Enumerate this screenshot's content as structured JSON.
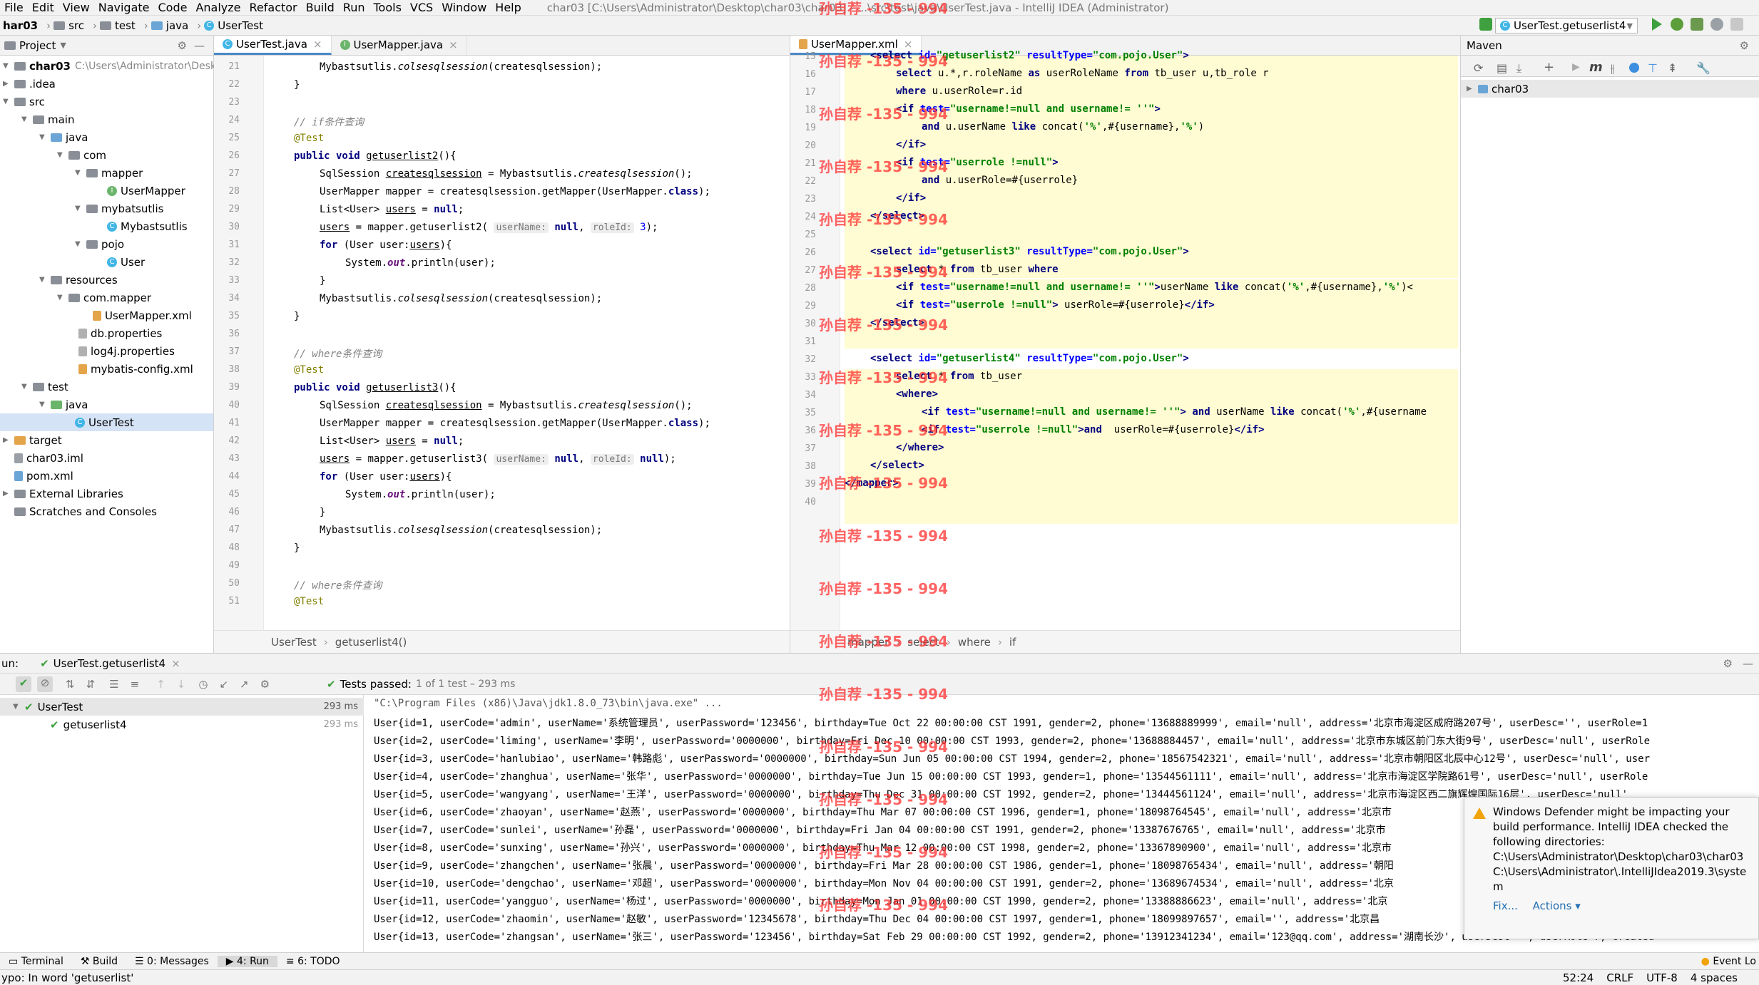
{
  "menu": [
    "File",
    "Edit",
    "View",
    "Navigate",
    "Code",
    "Analyze",
    "Refactor",
    "Build",
    "Run",
    "Tools",
    "VCS",
    "Window",
    "Help"
  ],
  "window_title": "char03 [C:\\Users\\Administrator\\Desktop\\char03\\char03] - ...\\src\\test\\java\\UserTest.java - IntelliJ IDEA (Administrator)",
  "breadcrumb": [
    "har03",
    "src",
    "test",
    "java",
    "UserTest"
  ],
  "run_config": "UserTest.getuserlist4",
  "project": {
    "header": "Project",
    "root": "char03",
    "root_path": "C:\\Users\\Administrator\\Deskt",
    "items": [
      ".idea",
      "src",
      "main",
      "java",
      "com",
      "mapper",
      "UserMapper",
      "mybatsutlis",
      "Mybastsutlis",
      "pojo",
      "User",
      "resources",
      "com.mapper",
      "UserMapper.xml",
      "db.properties",
      "log4j.properties",
      "mybatis-config.xml",
      "test",
      "java",
      "UserTest",
      "target",
      "char03.iml",
      "pom.xml",
      "External Libraries",
      "Scratches and Consoles"
    ]
  },
  "editor1": {
    "tabs": [
      "UserTest.java",
      "UserMapper.java"
    ],
    "line_numbers": [
      "21",
      "22",
      "23",
      "24",
      "25",
      "26",
      "27",
      "28",
      "29",
      "30",
      "31",
      "32",
      "33",
      "34",
      "35",
      "36",
      "37",
      "38",
      "39",
      "40",
      "41",
      "42",
      "43",
      "44",
      "45",
      "46",
      "47",
      "48",
      "49",
      "50",
      "51"
    ],
    "breadcrumb": [
      "UserTest",
      "getuserlist4()"
    ],
    "comments": [
      "// if条件查询",
      "// where条件查询",
      "// where条件查询"
    ]
  },
  "editor2": {
    "tab": "UserMapper.xml",
    "line_numbers": [
      "15",
      "16",
      "17",
      "18",
      "19",
      "20",
      "21",
      "22",
      "23",
      "24",
      "25",
      "26",
      "27",
      "28",
      "29",
      "30",
      "31",
      "32",
      "33",
      "34",
      "35",
      "36",
      "37",
      "38",
      "39",
      "40"
    ],
    "breadcrumb": [
      "mapper",
      "select",
      "where",
      "if"
    ]
  },
  "maven": {
    "header": "Maven",
    "root": "char03"
  },
  "run": {
    "label": "un:",
    "tab": "UserTest.getuserlist4",
    "tests_passed": "Tests passed:",
    "tests_count": "1 of 1 test – 293 ms",
    "tree": [
      {
        "name": "UserTest",
        "time": "293 ms"
      },
      {
        "name": "getuserlist4",
        "time": "293 ms"
      }
    ],
    "console": [
      "\"C:\\Program Files (x86)\\Java\\jdk1.8.0_73\\bin\\java.exe\" ...",
      "User{id=1, userCode='admin', userName='系统管理员', userPassword='123456', birthday=Tue Oct 22 00:00:00 CST 1991, gender=2, phone='13688889999', email='null', address='北京市海淀区成府路207号', userDesc='', userRole=1",
      "User{id=2, userCode='liming', userName='李明', userPassword='0000000', birthday=Fri Dec 10 00:00:00 CST 1993, gender=2, phone='13688884457', email='null', address='北京市东城区前门东大街9号', userDesc='null', userRole",
      "User{id=3, userCode='hanlubiao', userName='韩路彪', userPassword='0000000', birthday=Sun Jun 05 00:00:00 CST 1994, gender=2, phone='18567542321', email='null', address='北京市朝阳区北辰中心12号', userDesc='null', user",
      "User{id=4, userCode='zhanghua', userName='张华', userPassword='0000000', birthday=Tue Jun 15 00:00:00 CST 1993, gender=1, phone='13544561111', email='null', address='北京市海淀区学院路61号', userDesc='null', userRole",
      "User{id=5, userCode='wangyang', userName='王洋', userPassword='0000000', birthday=Thu Dec 31 00:00:00 CST 1992, gender=2, phone='13444561124', email='null', address='北京市海淀区西二旗辉煌国际16层', userDesc='null'",
      "User{id=6, userCode='zhaoyan', userName='赵燕', userPassword='0000000', birthday=Thu Mar 07 00:00:00 CST 1996, gender=1, phone='18098764545', email='null', address='北京市",
      "User{id=7, userCode='sunlei', userName='孙磊', userPassword='0000000', birthday=Fri Jan 04 00:00:00 CST 1991, gender=2, phone='13387676765', email='null', address='北京市",
      "User{id=8, userCode='sunxing', userName='孙兴', userPassword='0000000', birthday=Thu Mar 12 00:00:00 CST 1998, gender=2, phone='13367890900', email='null', address='北京市",
      "User{id=9, userCode='zhangchen', userName='张晨', userPassword='0000000', birthday=Fri Mar 28 00:00:00 CST 1986, gender=1, phone='18098765434', email='null', address='朝阳",
      "User{id=10, userCode='dengchao', userName='邓超', userPassword='0000000', birthday=Mon Nov 04 00:00:00 CST 1991, gender=2, phone='13689674534', email='null', address='北京",
      "User{id=11, userCode='yangguo', userName='杨过', userPassword='0000000', birthday=Mon Jan 01 00:00:00 CST 1990, gender=2, phone='13388886623', email='null', address='北京",
      "User{id=12, userCode='zhaomin', userName='赵敏', userPassword='12345678', birthday=Thu Dec 04 00:00:00 CST 1997, gender=1, phone='18099897657', email='', address='北京昌",
      "User{id=13, userCode='zhangsan', userName='张三', userPassword='123456', birthday=Sat Feb 29 00:00:00 CST 1992, gender=2, phone='13912341234', email='123@qq.com', address='湖南长沙', userDesc='', userRole=7, created"
    ]
  },
  "notification": {
    "text": "Windows Defender might be impacting your build performance. IntelliJ IDEA checked the following directories:",
    "dir1": "C:\\Users\\Administrator\\Desktop\\char03\\char03",
    "dir2": "C:\\Users\\Administrator\\.IntelliJIdea2019.3\\system",
    "fix": "Fix...",
    "actions": "Actions ▾"
  },
  "toolwindows": [
    "Terminal",
    "Build",
    "0: Messages",
    "4: Run",
    "6: TODO"
  ],
  "event_log": "Event Lo",
  "status": {
    "message": "ypo: In word 'getuserlist'",
    "position": "52:24",
    "line_sep": "CRLF",
    "encoding": "UTF-8",
    "indent": "4 spaces"
  },
  "watermark": "孙自荐 -135 - 994",
  "colors": {
    "accent": "#4a88c7",
    "run_green": "#3fa03f",
    "xml_highlight": "#fffbd2",
    "watermark": "#ff2f2f"
  }
}
